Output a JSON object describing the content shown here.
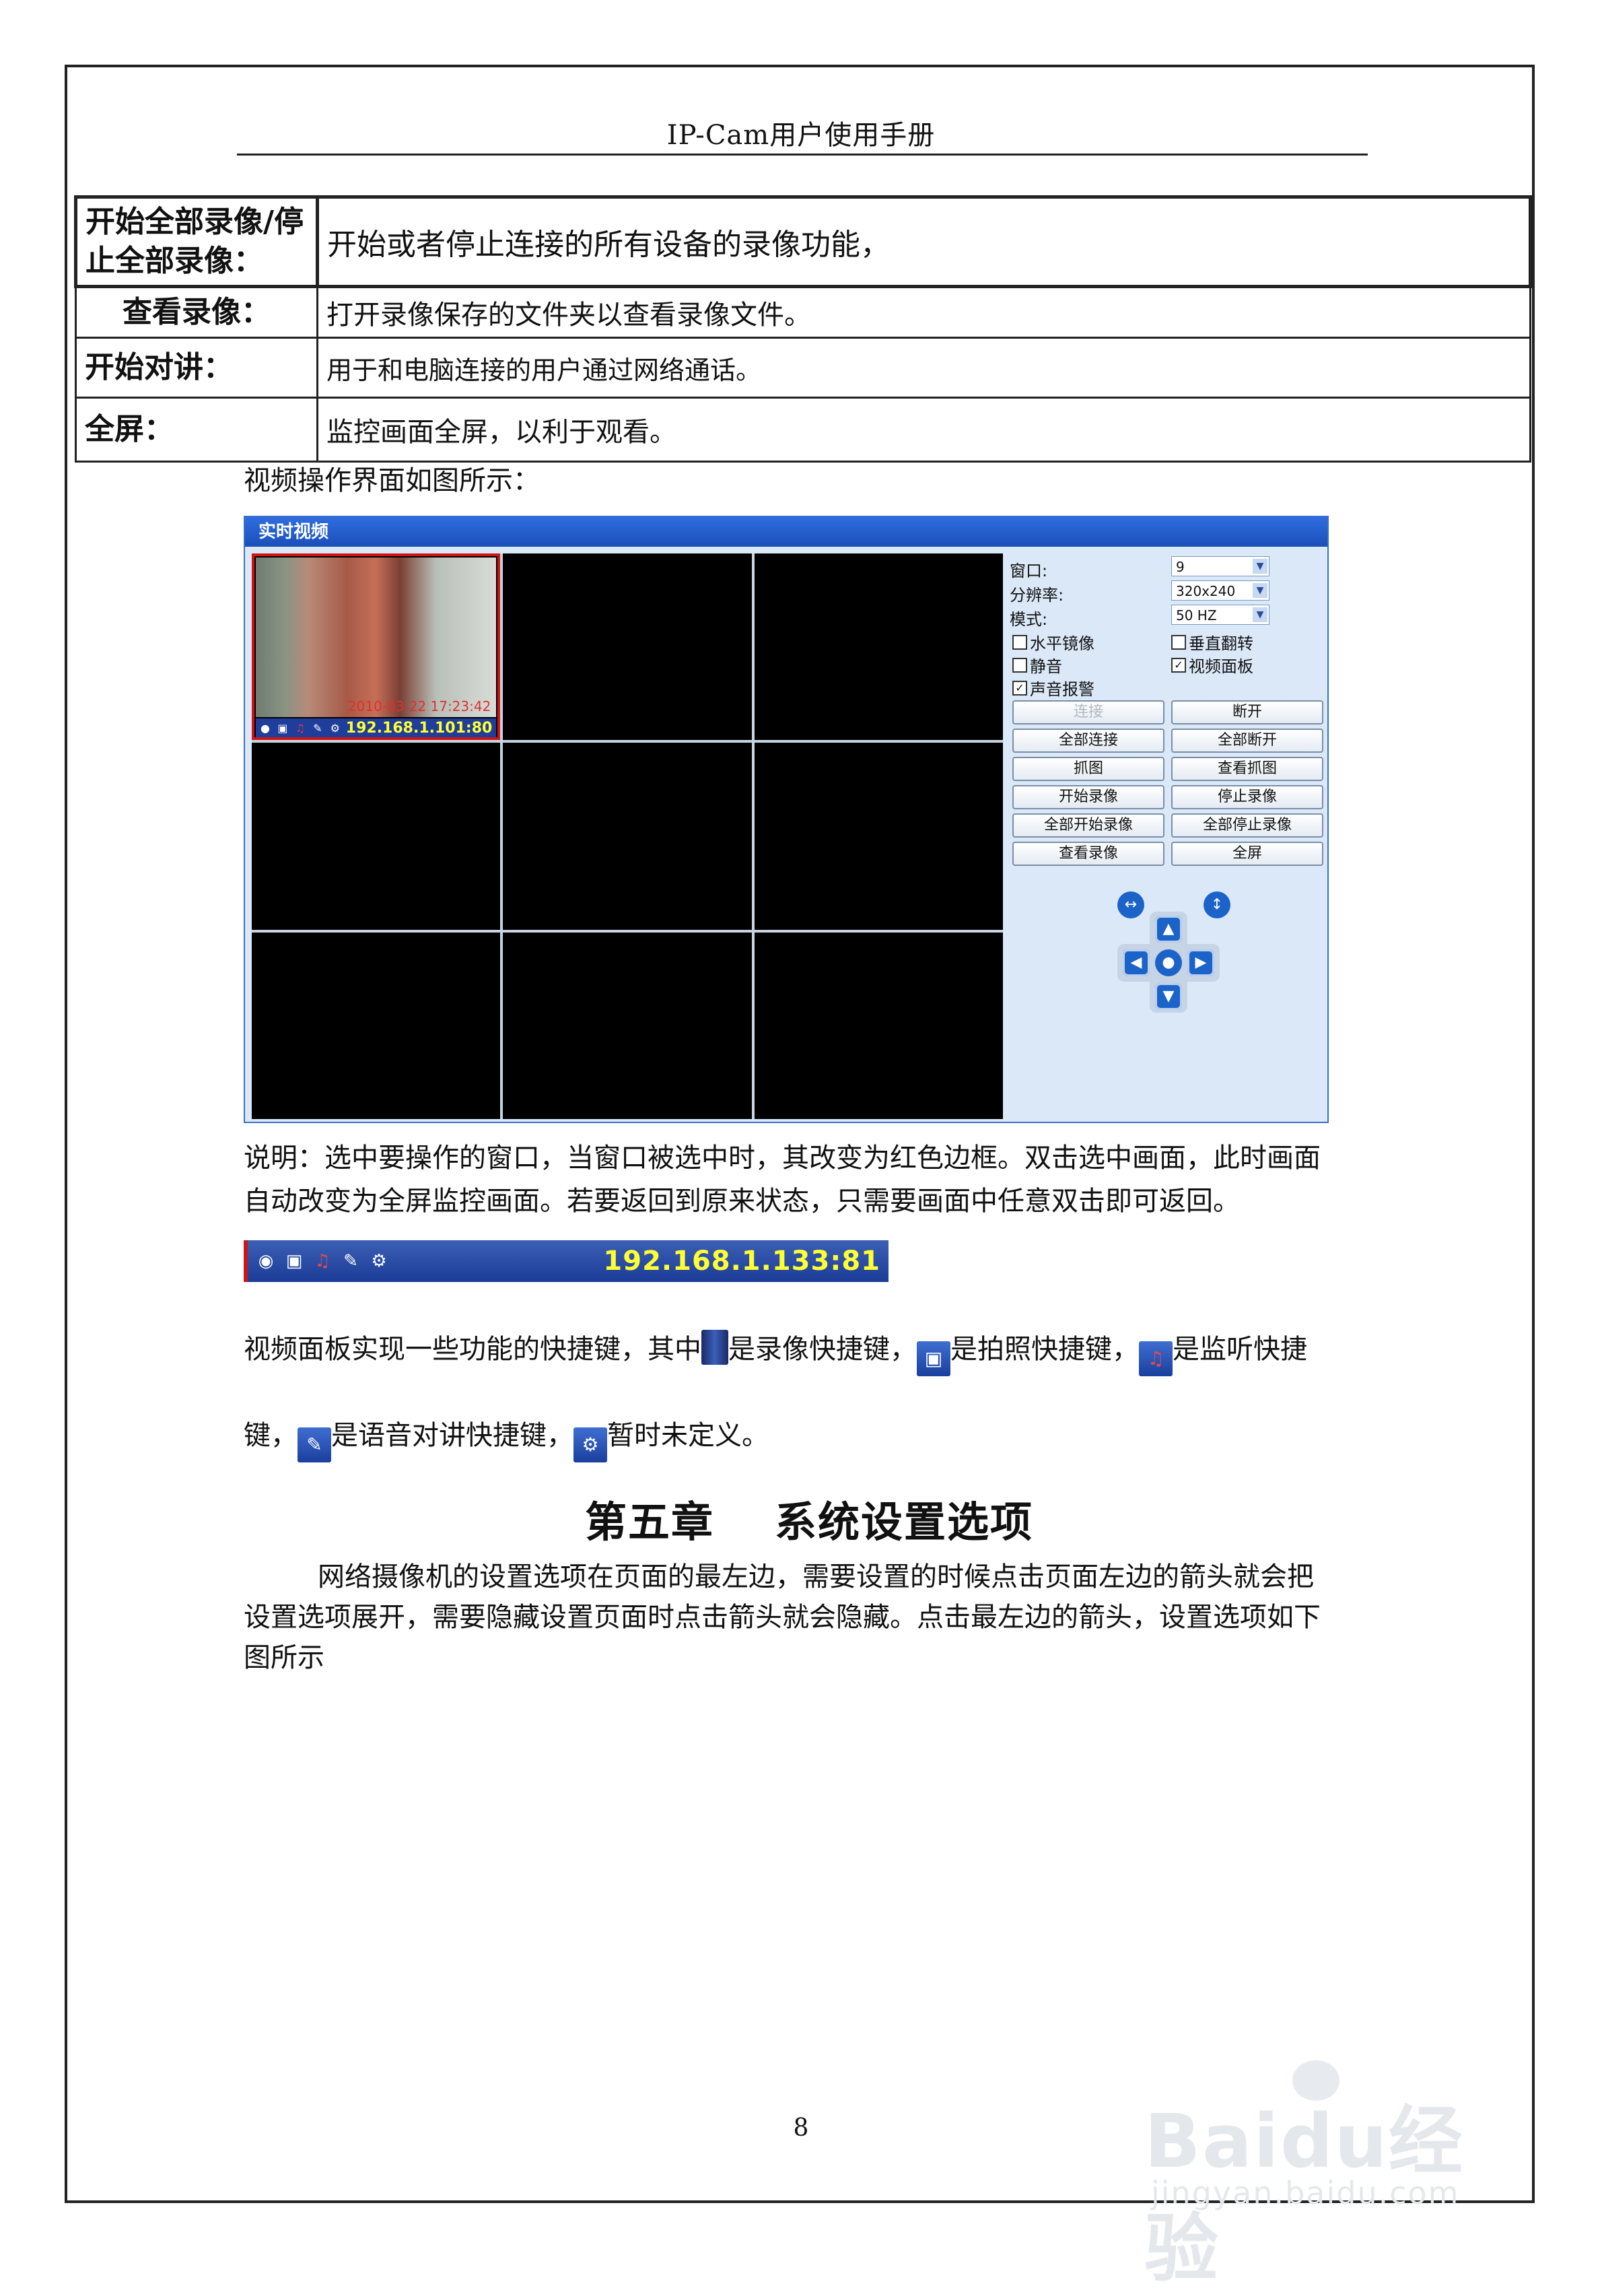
{
  "header": {
    "title": "IP-Cam用户使用手册"
  },
  "table": [
    {
      "key": "开始全部录像/停止全部录像：",
      "value": "开始或者停止连接的所有设备的录像功能，"
    },
    {
      "key": "查看录像：",
      "value": "打开录像保存的文件夹以查看录像文件。"
    },
    {
      "key": "开始对讲：",
      "value": "用于和电脑连接的用户通过网络通话。"
    },
    {
      "key": "全屏：",
      "value": "监控画面全屏，以利于观看。"
    }
  ],
  "intro": "视频操作界面如图所示：",
  "window": {
    "title": "实时视频",
    "cam": {
      "timestamp": "2010-03-22 17:23:42",
      "ip": "192.168.1.101:80"
    },
    "fields": [
      {
        "label": "窗口:",
        "value": "9"
      },
      {
        "label": "分辨率:",
        "value": "320x240"
      },
      {
        "label": "模式:",
        "value": "50 HZ"
      }
    ],
    "checkboxes": [
      {
        "label": "水平镜像",
        "checked": false
      },
      {
        "label": "垂直翻转",
        "checked": false
      },
      {
        "label": "静音",
        "checked": false
      },
      {
        "label": "视频面板",
        "checked": true
      },
      {
        "label": "声音报警",
        "checked": true
      }
    ],
    "buttons": [
      "连接",
      "断开",
      "全部连接",
      "全部断开",
      "抓图",
      "查看抓图",
      "开始录像",
      "停止录像",
      "全部开始录像",
      "全部停止录像",
      "查看录像",
      "全屏"
    ]
  },
  "note_lines": [
    "说明：选中要操作的窗口，当窗口被选中时，其改变为红色边框。双击选中画面，此时画面",
    "自动改变为全屏监控画面。若要返回到原来状态，只需要画面中任意双击即可返回。"
  ],
  "toolbar": {
    "ip": "192.168.1.133:81"
  },
  "shortcut_text": {
    "p1": "视频面板实现一些功能的快捷键，其中",
    "p2": "是录像快捷键，",
    "p3": "是拍照快捷键，",
    "p4": "是监听快捷",
    "p5": "键，",
    "p6": "是语音对讲快捷键，",
    "p7": "暂时未定义。"
  },
  "chapter": {
    "number": "第五章",
    "title": "系统设置选项"
  },
  "body_lines": [
    "网络摄像机的设置选项在页面的最左边，需要设置的时候点击页面左边的箭头就会把",
    "设置选项展开，需要隐藏设置页面时点击箭头就会隐藏。点击最左边的箭头，设置选项如下",
    "图所示"
  ],
  "page_number": "8",
  "watermark": {
    "main": "Baidu经验",
    "sub": "jingyan.baidu.com"
  },
  "colors": {
    "window_title": "#1f5fd0",
    "selected_border": "#d01414",
    "ip_text": "#ffff33"
  },
  "icons": [
    "record-icon",
    "camera-icon",
    "listen-icon",
    "talk-icon",
    "settings-icon"
  ]
}
